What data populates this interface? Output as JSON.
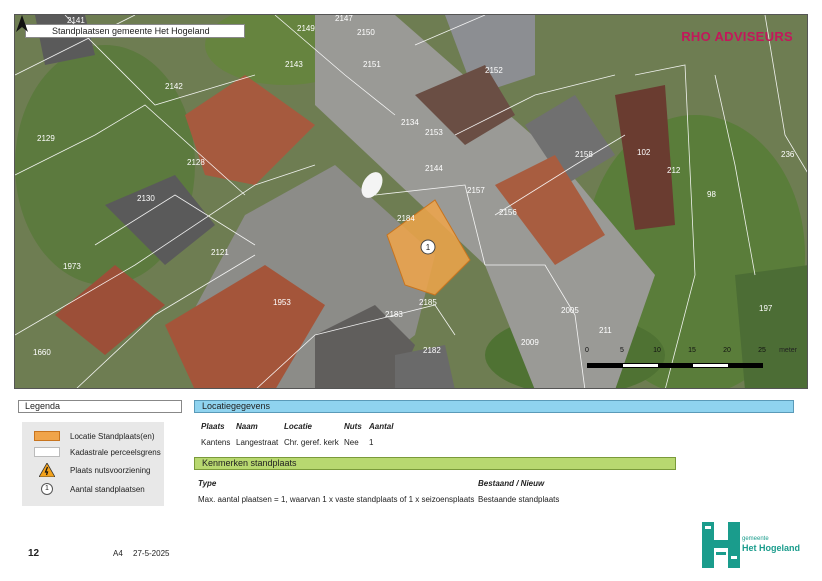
{
  "map": {
    "title": "Standplaatsen gemeente Het Hogeland",
    "brand": "RHO ADVISEURS",
    "marker_label": "1",
    "parcel_labels": [
      "2141",
      "2147",
      "2149",
      "2150",
      "2151",
      "2143",
      "2142",
      "2129",
      "2128",
      "2130",
      "2121",
      "1973",
      "1953",
      "1660",
      "2134",
      "2153",
      "2152",
      "2158",
      "2144",
      "2157",
      "2156",
      "2184",
      "2183",
      "2185",
      "2182",
      "2005",
      "2009",
      "211",
      "102",
      "212",
      "98",
      "236",
      "197"
    ],
    "scale": {
      "ticks": [
        "0",
        "5",
        "10",
        "15",
        "20",
        "25"
      ],
      "unit": "meter"
    }
  },
  "legend": {
    "title": "Legenda",
    "items": [
      {
        "symbol": "orange-swatch",
        "label": "Locatie Standplaats(en)",
        "color": "#f0a44a"
      },
      {
        "symbol": "white-swatch",
        "label": "Kadastrale perceelsgrens",
        "color": "#ffffff"
      },
      {
        "symbol": "warning-icon",
        "label": "Plaats nutsvoorziening"
      },
      {
        "symbol": "circle-number-icon",
        "number": "1",
        "label": "Aantal standplaatsen"
      }
    ]
  },
  "locatie": {
    "header": "Locatiegegevens",
    "columns": [
      "Plaats",
      "Naam",
      "Locatie",
      "Nuts",
      "Aantal"
    ],
    "row": [
      "Kantens",
      "Langestraat",
      "Chr. geref. kerk",
      "Nee",
      "1"
    ]
  },
  "kenmerken": {
    "header": "Kenmerken standplaats",
    "columns": [
      "Type",
      "Bestaand / Nieuw"
    ],
    "row": [
      "Max. aantal plaatsen = 1, waarvan 1 x vaste standplaats of 1 x seizoensplaats",
      "Bestaande standplaats"
    ]
  },
  "footer": {
    "page": "12",
    "format": "A4",
    "date": "27-5-2025",
    "logo_small": "gemeente",
    "logo_big": "Het Hogeland"
  }
}
